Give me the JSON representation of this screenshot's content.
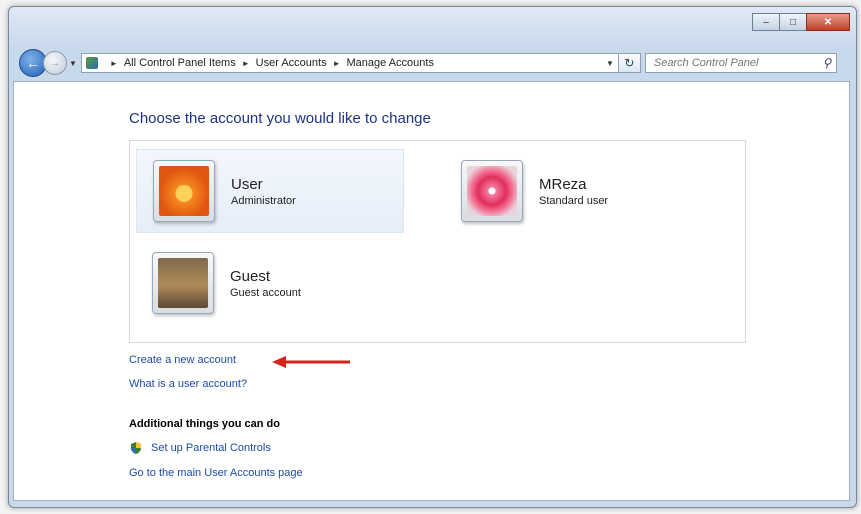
{
  "address_bar": {
    "crumbs": [
      "All Control Panel Items",
      "User Accounts",
      "Manage Accounts"
    ]
  },
  "search": {
    "placeholder": "Search Control Panel"
  },
  "page": {
    "title": "Choose the account you would like to change"
  },
  "accounts": [
    {
      "name": "User",
      "role": "Administrator",
      "picture": "orange-flower"
    },
    {
      "name": "MReza",
      "role": "Standard user",
      "picture": "pink-flower"
    },
    {
      "name": "Guest",
      "role": "Guest account",
      "picture": "briefcase"
    }
  ],
  "links": {
    "create_account": "Create a new account",
    "what_is": "What is a user account?"
  },
  "additional": {
    "heading": "Additional things you can do",
    "parental": "Set up Parental Controls",
    "main_page": "Go to the main User Accounts page"
  },
  "colors": {
    "link": "#1e4aa8",
    "title": "#1e3287",
    "arrow": "#d4231b"
  }
}
